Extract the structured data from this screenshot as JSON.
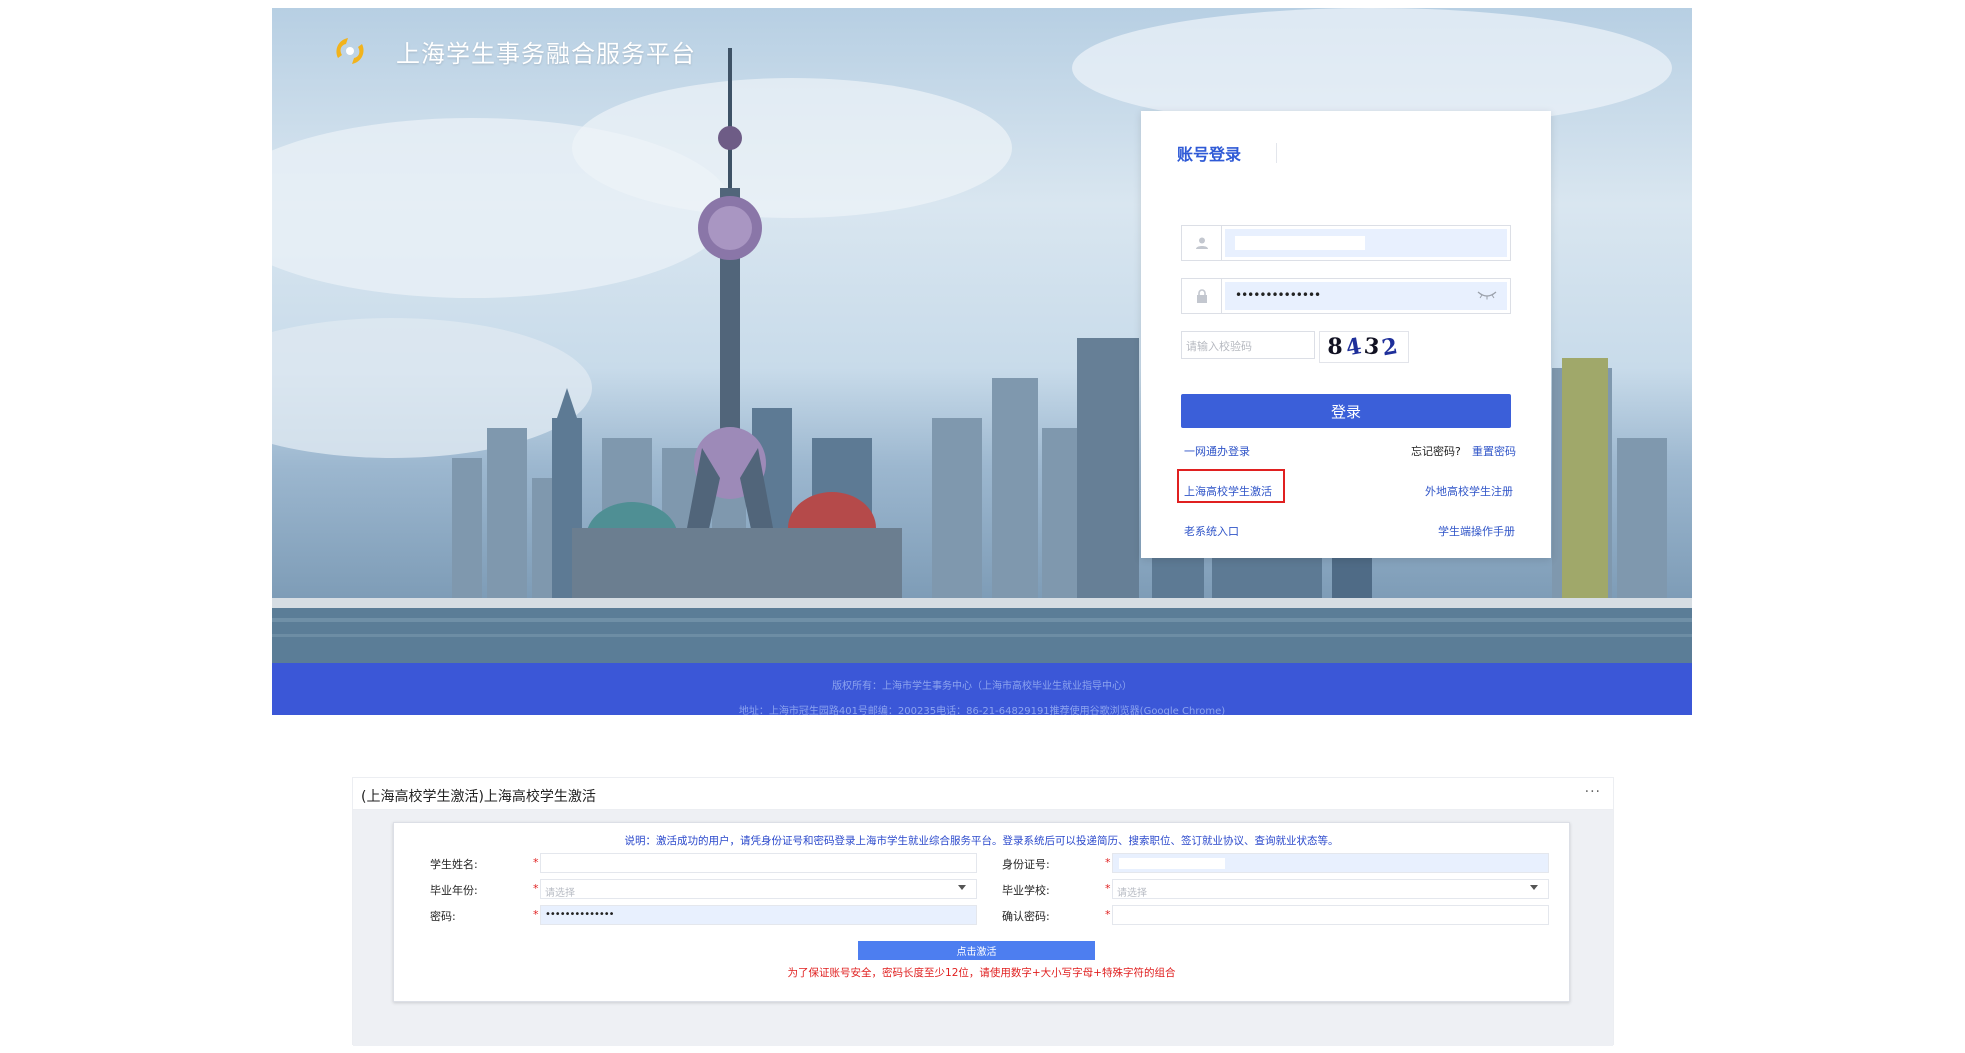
{
  "header": {
    "title": "上海学生事务融合服务平台"
  },
  "login": {
    "tab_label": "账号登录",
    "password_mask": "••••••••••••••",
    "captcha_placeholder": "请输入校验码",
    "captcha_digits": [
      "8",
      "4",
      "3",
      "2"
    ],
    "login_button": "登录",
    "links": {
      "one_net_login": "一网通办登录",
      "forgot_prefix": "忘记密码?",
      "reset_password": "重置密码",
      "sh_student_activation": "上海高校学生激活",
      "nonlocal_register": "外地高校学生注册",
      "old_system": "老系统入口",
      "student_manual": "学生端操作手册"
    }
  },
  "footer": {
    "copyright": "版权所有：上海市学生事务中心（上海市高校毕业生就业指导中心）",
    "address": "地址：上海市冠生园路401号邮编：200235电话：86-21-64829191推荐使用谷歌浏览器(Google Chrome)"
  },
  "activation": {
    "title": "(上海高校学生激活)上海高校学生激活",
    "more": "···",
    "notice": "说明：激活成功的用户，请凭身份证号和密码登录上海市学生就业综合服务平台。登录系统后可以投递简历、搜索职位、签订就业协议、查询就业状态等。",
    "fields": {
      "student_name": "学生姓名:",
      "id_number": "身份证号:",
      "grad_year": "毕业年份:",
      "grad_school": "毕业学校:",
      "password": "密码:",
      "confirm_password": "确认密码:"
    },
    "select_placeholder": "请选择",
    "required_mark": "*",
    "password_mask": "••••••••••••••",
    "activate_button": "点击激活",
    "warning": "为了保证账号安全，密码长度至少12位，请使用数字+大小写字母+特殊字符的组合"
  },
  "colors": {
    "primary": "#3b5fd9",
    "footer_bar": "#3b57d7",
    "link": "#3055c8",
    "alert_red": "#e02020"
  }
}
